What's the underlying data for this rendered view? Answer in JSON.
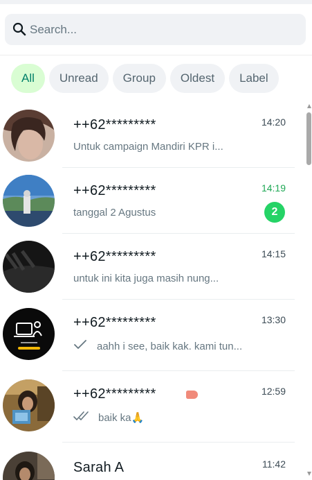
{
  "search": {
    "placeholder": "Search..."
  },
  "filters": [
    {
      "label": "All",
      "active": true
    },
    {
      "label": "Unread",
      "active": false
    },
    {
      "label": "Group",
      "active": false
    },
    {
      "label": "Oldest",
      "active": false
    },
    {
      "label": "Label",
      "active": false
    }
  ],
  "chats": [
    {
      "name": "++62*********",
      "time": "14:20",
      "preview": "Untuk campaign Mandiri KPR i...",
      "unread": false
    },
    {
      "name": "++62*********",
      "time": "14:19",
      "preview": "tanggal 2 Agustus",
      "unread": true,
      "unread_count": "2"
    },
    {
      "name": "++62*********",
      "time": "14:15",
      "preview": "untuk ini kita juga masih nung...",
      "unread": false
    },
    {
      "name": "++62*********",
      "time": "13:30",
      "preview": "aahh i see, baik kak. kami tun...",
      "status": "sent-single-tick",
      "unread": false
    },
    {
      "name": "++62*********",
      "time": "12:59",
      "preview": "baik ka🙏",
      "status": "delivered-double-tick",
      "has_label_tag": true,
      "unread": false
    },
    {
      "name": "Sarah A",
      "time": "11:42",
      "preview": "",
      "unread": false
    }
  ],
  "colors": {
    "accent_green": "#1fa855",
    "badge_green": "#25d366",
    "active_chip_bg": "#d9fdd3",
    "active_chip_text": "#008069",
    "label_tag": "#f08a7a"
  },
  "icons": {
    "search": "search-icon",
    "sent": "single-check-icon",
    "delivered": "double-check-icon",
    "label": "label-tag-icon"
  }
}
